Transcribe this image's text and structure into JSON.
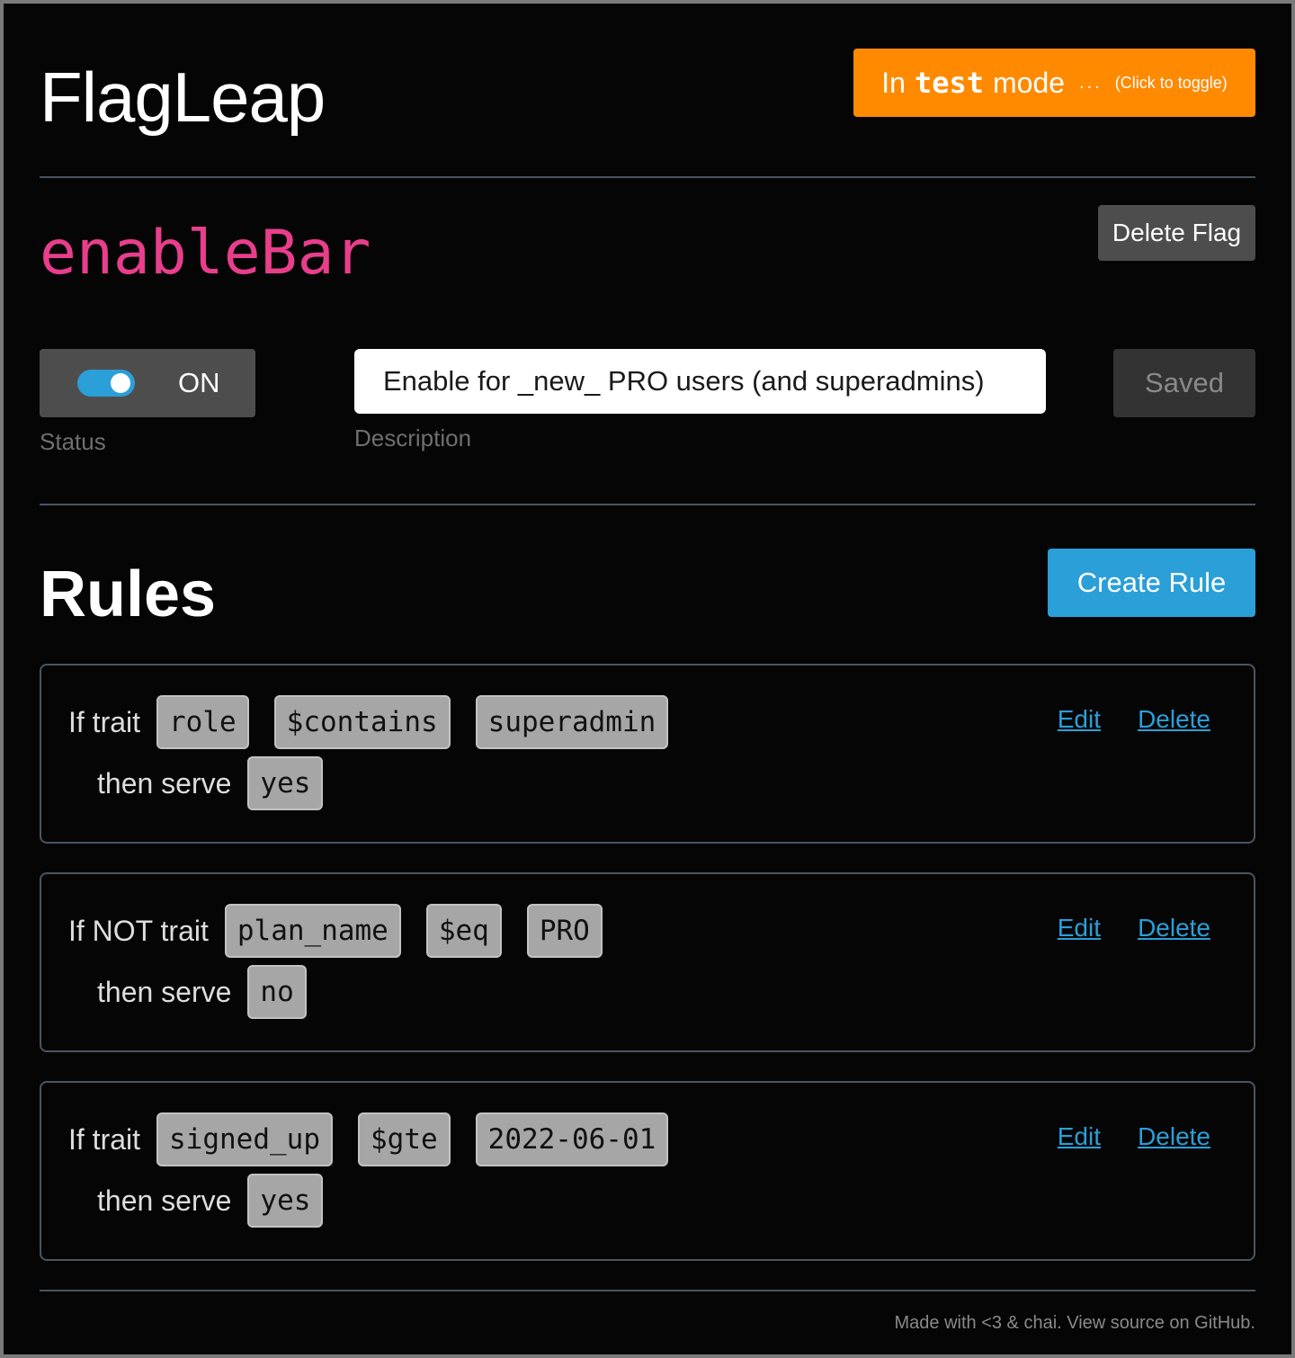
{
  "app": {
    "title": "FlagLeap",
    "mode_prefix": "In",
    "mode_name": "test",
    "mode_suffix": "mode",
    "mode_dots": "...",
    "mode_hint": "(Click to toggle)"
  },
  "flag": {
    "name": "enableBar",
    "delete_label": "Delete Flag",
    "status_value": "ON",
    "status_enabled": true,
    "status_label": "Status",
    "description_value": "Enable for _new_ PRO users (and superadmins)",
    "description_label": "Description",
    "saved_label": "Saved"
  },
  "rules": {
    "title": "Rules",
    "create_label": "Create Rule",
    "items": [
      {
        "prefix": "If trait",
        "trait": "role",
        "operator": "$contains",
        "value": "superadmin",
        "serve_label": "then serve",
        "serve": "yes",
        "edit_label": "Edit",
        "delete_label": "Delete"
      },
      {
        "prefix": "If NOT trait",
        "trait": "plan_name",
        "operator": "$eq",
        "value": "PRO",
        "serve_label": "then serve",
        "serve": "no",
        "edit_label": "Edit",
        "delete_label": "Delete"
      },
      {
        "prefix": "If trait",
        "trait": "signed_up",
        "operator": "$gte",
        "value": "2022-06-01",
        "serve_label": "then serve",
        "serve": "yes",
        "edit_label": "Edit",
        "delete_label": "Delete"
      }
    ]
  },
  "footer": {
    "text": "Made with <3 & chai. View source on GitHub."
  },
  "colors": {
    "background": "#050505",
    "mode_orange": "#ff8a00",
    "flag_pink": "#e83e8c",
    "accent_blue": "#2a9fd8",
    "chip_gray": "#a6a6a6"
  }
}
